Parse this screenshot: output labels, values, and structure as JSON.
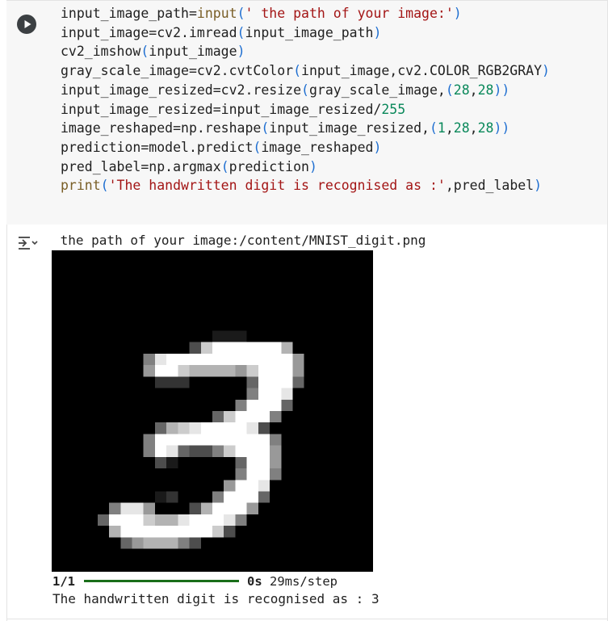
{
  "code_cell": {
    "lines": [
      [
        {
          "t": "input_image_path=",
          "c": ""
        },
        {
          "t": "input",
          "c": "fn"
        },
        {
          "t": "(",
          "c": "par"
        },
        {
          "t": "' the path of your image:'",
          "c": "str"
        },
        {
          "t": ")",
          "c": "par"
        }
      ],
      [
        {
          "t": "input_image=cv2.imread",
          "c": ""
        },
        {
          "t": "(",
          "c": "par"
        },
        {
          "t": "input_image_path",
          "c": ""
        },
        {
          "t": ")",
          "c": "par"
        }
      ],
      [
        {
          "t": "cv2_imshow",
          "c": ""
        },
        {
          "t": "(",
          "c": "par"
        },
        {
          "t": "input_image",
          "c": ""
        },
        {
          "t": ")",
          "c": "par"
        }
      ],
      [
        {
          "t": "gray_scale_image=cv2.cvtColor",
          "c": ""
        },
        {
          "t": "(",
          "c": "par"
        },
        {
          "t": "input_image,cv2.COLOR_RGB2GRAY",
          "c": ""
        },
        {
          "t": ")",
          "c": "par"
        }
      ],
      [
        {
          "t": "input_image_resized=cv2.resize",
          "c": ""
        },
        {
          "t": "(",
          "c": "par"
        },
        {
          "t": "gray_scale_image,",
          "c": ""
        },
        {
          "t": "(",
          "c": "par"
        },
        {
          "t": "28",
          "c": "num"
        },
        {
          "t": ",",
          "c": ""
        },
        {
          "t": "28",
          "c": "num"
        },
        {
          "t": "))",
          "c": "par"
        }
      ],
      [
        {
          "t": "input_image_resized=input_image_resized/",
          "c": ""
        },
        {
          "t": "255",
          "c": "num"
        }
      ],
      [
        {
          "t": "image_reshaped=np.reshape",
          "c": ""
        },
        {
          "t": "(",
          "c": "par"
        },
        {
          "t": "input_image_resized,",
          "c": ""
        },
        {
          "t": "(",
          "c": "par"
        },
        {
          "t": "1",
          "c": "num"
        },
        {
          "t": ",",
          "c": ""
        },
        {
          "t": "28",
          "c": "num"
        },
        {
          "t": ",",
          "c": ""
        },
        {
          "t": "28",
          "c": "num"
        },
        {
          "t": "))",
          "c": "par"
        }
      ],
      [
        {
          "t": "prediction=model.predict",
          "c": ""
        },
        {
          "t": "(",
          "c": "par"
        },
        {
          "t": "image_reshaped",
          "c": ""
        },
        {
          "t": ")",
          "c": "par"
        }
      ],
      [
        {
          "t": "pred_label=np.argmax",
          "c": ""
        },
        {
          "t": "(",
          "c": "par"
        },
        {
          "t": "prediction",
          "c": ""
        },
        {
          "t": ")",
          "c": "par"
        }
      ],
      [
        {
          "t": "print",
          "c": "kw"
        },
        {
          "t": "(",
          "c": "par"
        },
        {
          "t": "'The handwritten digit is recognised as :'",
          "c": "str"
        },
        {
          "t": ",pred_label",
          "c": ""
        },
        {
          "t": ")",
          "c": "par"
        }
      ]
    ],
    "run_icon": "play-circle-icon"
  },
  "output": {
    "gutter_icon": "output-toggle-icon",
    "prompt_line": " the path of your image:/content/MNIST_digit.png",
    "progress": {
      "count": "1/1",
      "fraction": 1.0,
      "time_bold": "0s",
      "time_rest": " 29ms/step"
    },
    "result_line": "The handwritten digit is recognised as : 3"
  },
  "colors": {
    "cell_bg": "#f7f7f7",
    "progress_fill": "#1a6e1a",
    "string": "#a31515",
    "number": "#09885a",
    "paren": "#1f6fd1",
    "function": "#795e26"
  }
}
